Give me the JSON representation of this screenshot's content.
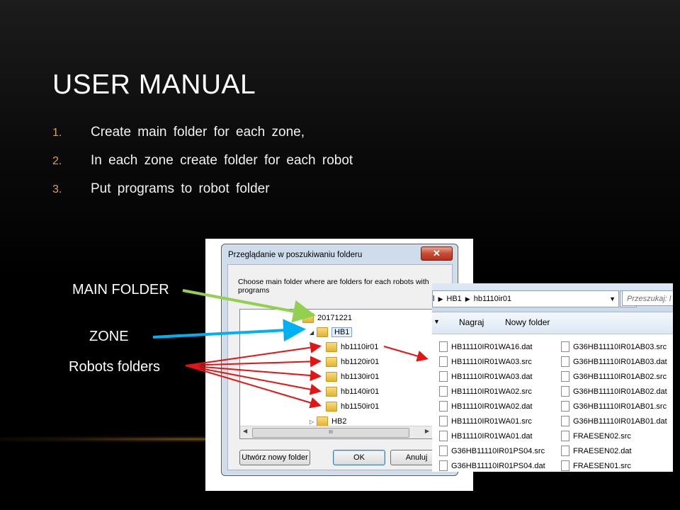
{
  "slide": {
    "title": "USER MANUAL",
    "bullets": [
      {
        "num": "1.",
        "text": "Create main folder for each zone,"
      },
      {
        "num": "2.",
        "text": "In each zone create folder for each robot"
      },
      {
        "num": "3.",
        "text": "Put programs to robot folder"
      }
    ],
    "labels": {
      "main_folder": "MAIN FOLDER",
      "zone": "ZONE",
      "robots": "Robots folders"
    }
  },
  "dialog": {
    "title": "Przeglądanie w poszukiwaniu folderu",
    "close": "✕",
    "description": "Choose main folder where are folders for each robots with programs",
    "tree": [
      {
        "label": "20171221"
      },
      {
        "label": "HB1"
      },
      {
        "label": "hb1110ir01"
      },
      {
        "label": "hb1120ir01"
      },
      {
        "label": "hb1130ir01"
      },
      {
        "label": "hb1140ir01"
      },
      {
        "label": "hb1150ir01"
      },
      {
        "label": "HB2"
      }
    ],
    "scroll_thumb": "III",
    "buttons": {
      "new_folder": "Utwórz nowy folder",
      "ok": "OK",
      "cancel": "Anuluj"
    }
  },
  "explorer": {
    "breadcrumb": [
      "l",
      "HB1",
      "hb1110ir01"
    ],
    "search_placeholder": "Przeszukaj: l",
    "toolbar": {
      "burn": "Nagraj",
      "new_folder": "Nowy folder"
    },
    "files_col1": [
      "HB11110IR01WA16.dat",
      "HB11110IR01WA03.src",
      "HB11110IR01WA03.dat",
      "HB11110IR01WA02.src",
      "HB11110IR01WA02.dat",
      "HB11110IR01WA01.src",
      "HB11110IR01WA01.dat",
      "G36HB11110IR01PS04.src",
      "G36HB11110IR01PS04.dat"
    ],
    "files_col2": [
      "G36HB11110IR01AB03.src",
      "G36HB11110IR01AB03.dat",
      "G36HB11110IR01AB02.src",
      "G36HB11110IR01AB02.dat",
      "G36HB11110IR01AB01.src",
      "G36HB11110IR01AB01.dat",
      "FRAESEN02.src",
      "FRAESEN02.dat",
      "FRAESEN01.src"
    ]
  },
  "colors": {
    "accent": "#e2a04a",
    "green_arrow": "#92d050",
    "blue_arrow": "#00b0f0",
    "red_arrow": "#e31414"
  }
}
